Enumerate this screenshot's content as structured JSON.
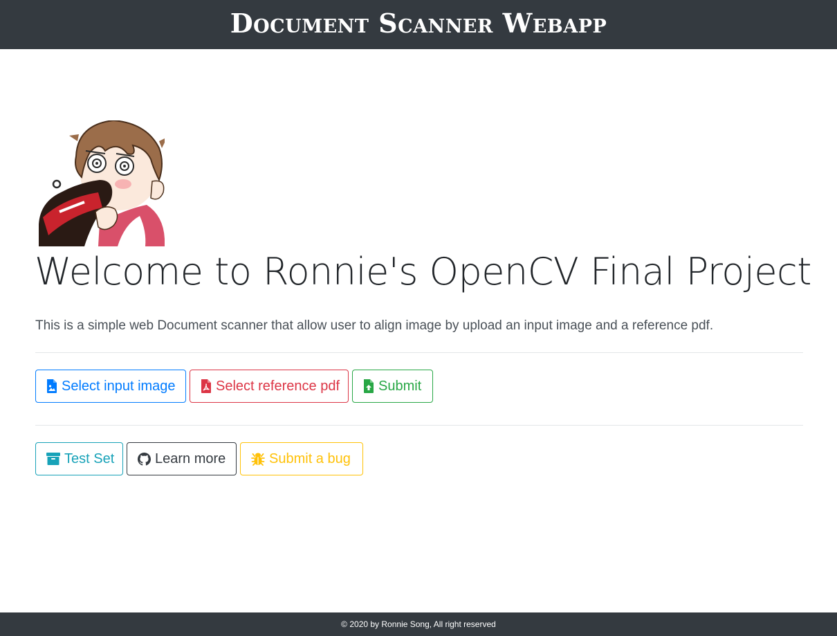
{
  "header": {
    "title": "Document Scanner Webapp",
    "background": "#343a40"
  },
  "hero": {
    "avatar_icon": "cartoon-avatar-drinking-cola",
    "title": "Welcome to Ronnie's OpenCV Final Project",
    "lead": "This is a simple web Document scanner that allow user to align image by upload an input image and a reference pdf."
  },
  "actions": {
    "select_image": {
      "label": "Select input image",
      "icon": "file-image-icon",
      "color": "#007bff"
    },
    "select_pdf": {
      "label": "Select reference pdf",
      "icon": "file-pdf-icon",
      "color": "#dc3545"
    },
    "submit": {
      "label": "Submit",
      "icon": "file-upload-icon",
      "color": "#28a745"
    }
  },
  "links": {
    "test_set": {
      "label": "Test Set",
      "icon": "archive-icon",
      "color": "#17a2b8"
    },
    "learn_more": {
      "label": "Learn more",
      "icon": "github-icon",
      "color": "#343a40"
    },
    "submit_bug": {
      "label": "Submit a bug",
      "icon": "bug-icon",
      "color": "#ffc107"
    }
  },
  "footer": {
    "text": "© 2020 by Ronnie Song, All right reserved"
  }
}
